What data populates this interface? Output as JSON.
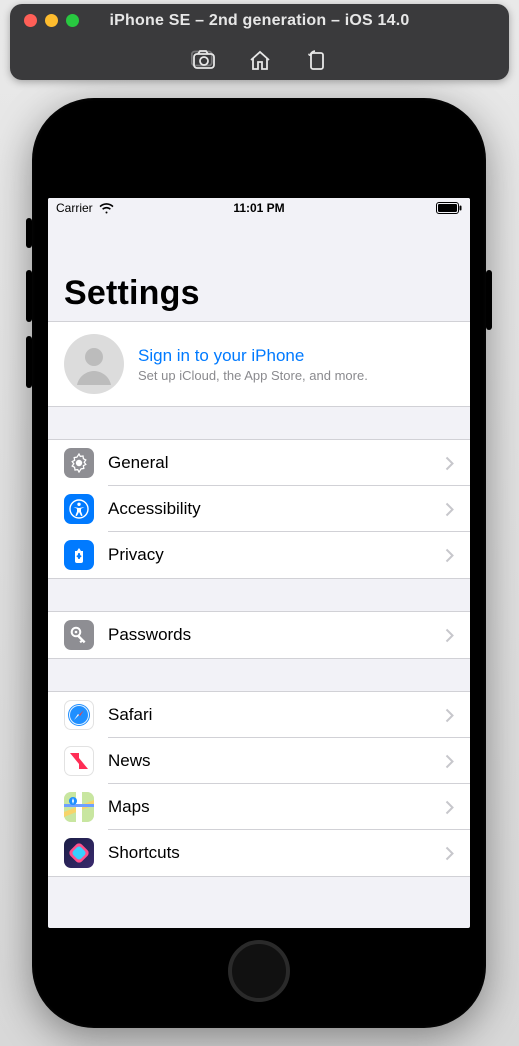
{
  "window": {
    "title": "iPhone SE – 2nd generation – iOS 14.0"
  },
  "status": {
    "carrier": "Carrier",
    "time": "11:01 PM"
  },
  "page": {
    "title": "Settings"
  },
  "signin": {
    "title": "Sign in to your iPhone",
    "subtitle": "Set up iCloud, the App Store, and more."
  },
  "groups": [
    {
      "items": [
        {
          "id": "general",
          "label": "General",
          "icon": "general"
        },
        {
          "id": "accessibility",
          "label": "Accessibility",
          "icon": "access"
        },
        {
          "id": "privacy",
          "label": "Privacy",
          "icon": "privacy"
        }
      ]
    },
    {
      "items": [
        {
          "id": "passwords",
          "label": "Passwords",
          "icon": "pass"
        }
      ]
    },
    {
      "items": [
        {
          "id": "safari",
          "label": "Safari",
          "icon": "safari"
        },
        {
          "id": "news",
          "label": "News",
          "icon": "news"
        },
        {
          "id": "maps",
          "label": "Maps",
          "icon": "maps"
        },
        {
          "id": "shortcuts",
          "label": "Shortcuts",
          "icon": "shortcuts"
        }
      ]
    }
  ]
}
